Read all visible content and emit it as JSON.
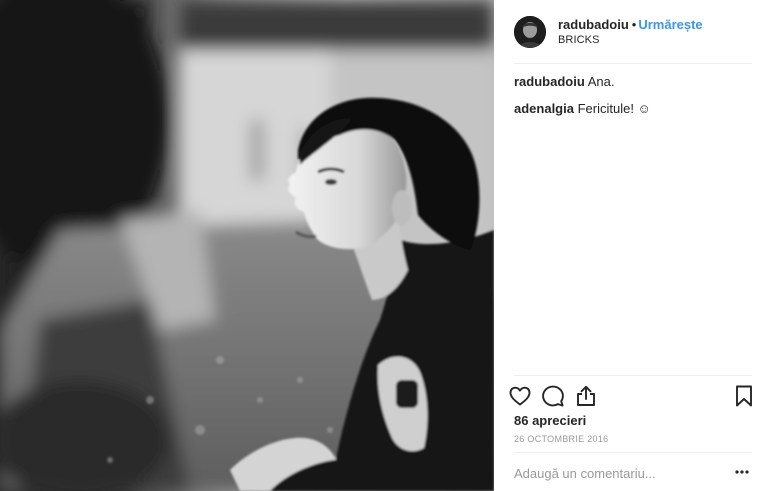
{
  "post": {
    "photo_alt": "",
    "header": {
      "username": "radubadoiu",
      "separator": "•",
      "follow_label": "Urmărește",
      "location": "BRICKS",
      "avatar_icon": "avatar"
    },
    "comments": [
      {
        "user": "radubadoiu",
        "text": "Ana."
      },
      {
        "user": "adenalgia",
        "text": "Fericitule! ☺"
      }
    ],
    "actions": {
      "like_icon": "heart-icon",
      "comment_icon": "speech-bubble-icon",
      "share_icon": "share-icon",
      "save_icon": "bookmark-icon"
    },
    "likes_text": "86 aprecieri",
    "date_text": "26 OCTOMBRIE 2016",
    "add_comment": {
      "placeholder": "Adaugă un comentariu..."
    },
    "more_icon": "ellipsis-icon"
  },
  "colors": {
    "follow_accent": "#3897f0",
    "text_primary": "#262626",
    "text_secondary": "#999999",
    "divider": "#efefef"
  }
}
